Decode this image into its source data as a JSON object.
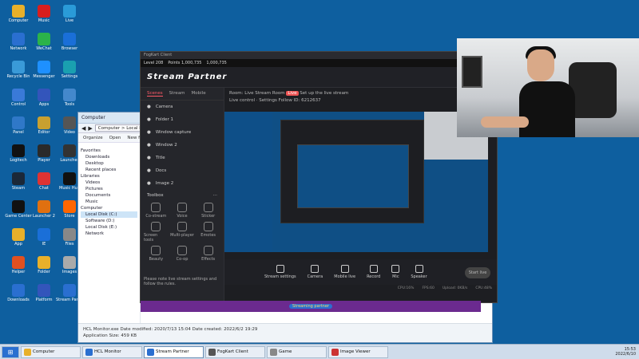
{
  "desktop": {
    "icons": [
      {
        "label": "Computer",
        "color": "#e8b02a"
      },
      {
        "label": "Music",
        "color": "#d81e1e"
      },
      {
        "label": "Live",
        "color": "#2a9bd8"
      },
      {
        "label": "Network",
        "color": "#2a6fd0"
      },
      {
        "label": "WeChat",
        "color": "#2bb34a"
      },
      {
        "label": "Browser",
        "color": "#1a6fd8"
      },
      {
        "label": "Recycle Bin",
        "color": "#3a9ad8"
      },
      {
        "label": "Messenger",
        "color": "#1e90ff"
      },
      {
        "label": "Settings",
        "color": "#1aa0b0"
      },
      {
        "label": "Control",
        "color": "#3a7ad8"
      },
      {
        "label": "Apps",
        "color": "#3355bb"
      },
      {
        "label": "Tools",
        "color": "#4488cc"
      },
      {
        "label": "Panel",
        "color": "#2f78c8"
      },
      {
        "label": "Editor",
        "color": "#c8a030"
      },
      {
        "label": "Video",
        "color": "#555"
      },
      {
        "label": "Logitech",
        "color": "#111"
      },
      {
        "label": "Player",
        "color": "#2a2a2a"
      },
      {
        "label": "Launcher",
        "color": "#333"
      },
      {
        "label": "Steam",
        "color": "#1b2838"
      },
      {
        "label": "Chat",
        "color": "#d33"
      },
      {
        "label": "Music Hub",
        "color": "#111"
      },
      {
        "label": "Game Center",
        "color": "#111"
      },
      {
        "label": "Launcher 2",
        "color": "#e07010"
      },
      {
        "label": "Store",
        "color": "#ff6600"
      },
      {
        "label": "App",
        "color": "#e8b02a"
      },
      {
        "label": "IE",
        "color": "#1a6fd8"
      },
      {
        "label": "Files",
        "color": "#888"
      },
      {
        "label": "Helper",
        "color": "#e05020"
      },
      {
        "label": "Folder",
        "color": "#e8b02a"
      },
      {
        "label": "Images",
        "color": "#aaa"
      },
      {
        "label": "Downloads",
        "color": "#2a6fd0"
      },
      {
        "label": "Platform",
        "color": "#3355bb"
      },
      {
        "label": "Stream Partner",
        "color": "#2a6fd0"
      }
    ]
  },
  "explorer": {
    "title": "Computer",
    "menu": [
      "Organize",
      "Open",
      "New folder"
    ],
    "address": "Computer > Local Disk",
    "nav": [
      "Favorites",
      "Downloads",
      "Desktop",
      "Recent places",
      "Libraries",
      "Videos",
      "Pictures",
      "Documents",
      "Music",
      "Computer",
      "Local Disk (C:)",
      "Software (D:)",
      "Local Disk (E:)",
      "Network"
    ],
    "status": {
      "file": "HCL Monitor.exe",
      "modified_label": "Date modified:",
      "modified": "2020/7/13 15:04",
      "created_label": "Date created:",
      "created": "2022/6/2 19:29",
      "type": "Application",
      "size_label": "Size:",
      "size": "459 KB"
    }
  },
  "stream": {
    "title": "FogKart Client",
    "game_bar": [
      "Level 208",
      "Points 1,000,735",
      "1,000,735"
    ],
    "logo": "Stream Partner",
    "tabs": [
      "Scenes",
      "Stream",
      "Mobile"
    ],
    "scenes": [
      "Camera",
      "Folder 1",
      "Window capture",
      "Window 2",
      "Title",
      "Docs",
      "Image 2"
    ],
    "tools_title": "Toolbox",
    "tools": [
      "Co-stream",
      "Voice",
      "Sticker",
      "Screen tools",
      "Multi-player",
      "Emotes",
      "Beauty",
      "Co-op",
      "Effects"
    ],
    "info": {
      "room": "Room: Live Stream Room",
      "tag": "Live",
      "warn": "Set up the live stream",
      "line2": "Live control · Settings",
      "follow": "Follow",
      "id": "ID: 6212637"
    },
    "controls": [
      "Stream settings",
      "Camera",
      "Mobile live",
      "Record",
      "Mic",
      "Speaker"
    ],
    "start": "Start live",
    "stats": [
      "CPU:16%",
      "FPS:60",
      "Upload: 0KB/s",
      "CPU:48%"
    ],
    "notice": "Please note live stream settings and follow the rules.",
    "banner": "Streaming partner"
  },
  "taskbar": {
    "tasks": [
      {
        "label": "Computer",
        "color": "#e8b02a"
      },
      {
        "label": "HCL Monitor",
        "color": "#2a6fd0"
      },
      {
        "label": "Stream Partner",
        "color": "#2a6fd0"
      },
      {
        "label": "FogKart Client",
        "color": "#555"
      },
      {
        "label": "Game",
        "color": "#888"
      },
      {
        "label": "Image Viewer",
        "color": "#c33"
      }
    ],
    "time": "15:53",
    "date": "2022/6/10"
  }
}
